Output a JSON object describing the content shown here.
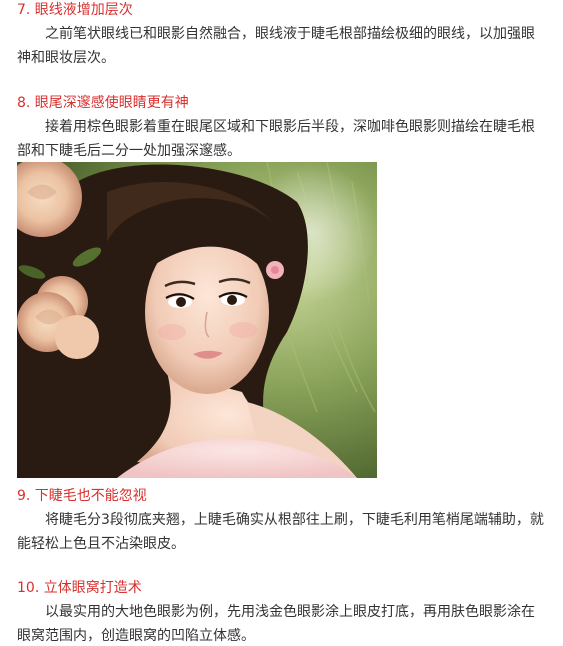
{
  "sections": [
    {
      "heading": "7. 眼线液增加层次",
      "text": "之前笔状眼线已和眼影自然融合，眼线液于睫毛根部描绘极细的眼线，以加强眼神和眼妆层次。"
    },
    {
      "heading": "8. 眼尾深邃感使眼睛更有神",
      "text": "接着用棕色眼影着重在眼尾区域和下眼影后半段，深咖啡色眼影则描绘在睫毛根部和下睫毛后二分一处加强深邃感。"
    },
    {
      "heading": "9. 下睫毛也不能忽视",
      "text": "将睫毛分3段彻底夹翘，上睫毛确实从根部往上刷，下睫毛利用笔梢尾端辅助，就能轻松上色且不沾染眼皮。"
    },
    {
      "heading": "10. 立体眼窝打造术",
      "text": "以最实用的大地色眼影为例，先用浅金色眼影涂上眼皮打底，再用肤色眼影涂在眼窝范围内，创造眼窝的凹陷立体感。"
    }
  ],
  "colors": {
    "heading": "#d8302f",
    "body_text": "#333333",
    "background": "#ffffff"
  }
}
